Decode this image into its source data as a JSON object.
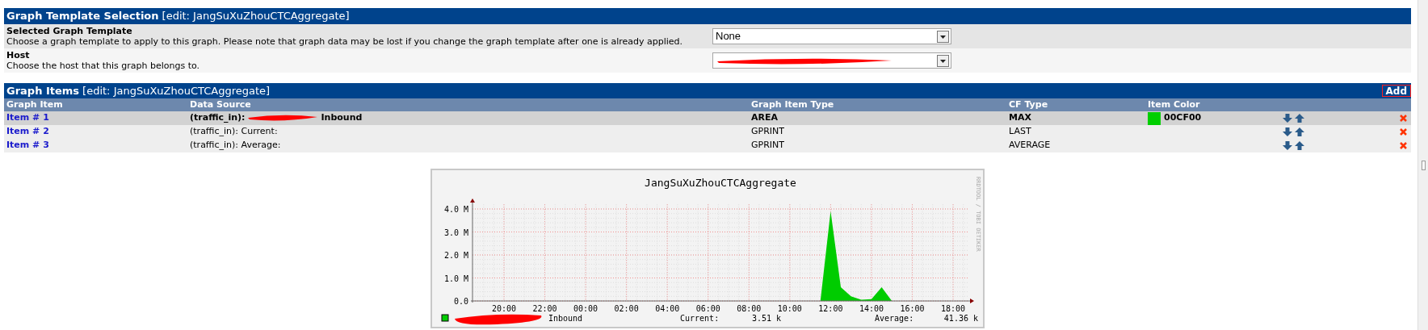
{
  "template_section": {
    "title": "Graph Template Selection",
    "subtitle": "[edit: JangSuXuZhouCTCAggregate]",
    "fields": [
      {
        "label": "Selected Graph Template",
        "description": "Choose a graph template to apply to this graph. Please note that graph data may be lost if you change the graph template after one is already applied.",
        "value": "None"
      },
      {
        "label": "Host",
        "description": "Choose the host that this graph belongs to.",
        "redacted": true
      }
    ]
  },
  "items_section": {
    "title": "Graph Items",
    "subtitle": "[edit: JangSuXuZhouCTCAggregate]",
    "add_button": "Add",
    "columns": [
      "Graph Item",
      "Data Source",
      "Graph Item Type",
      "CF Type",
      "Item Color"
    ],
    "rows": [
      {
        "item": "Item # 1",
        "source_prefix": "(traffic_in):",
        "source_redacted": true,
        "source_suffix": "Inbound",
        "type": "AREA",
        "cf": "MAX",
        "color": "#00cf00",
        "color_label": "00CF00",
        "highlighted": true
      },
      {
        "item": "Item # 2",
        "source_prefix": "(traffic_in): Current:",
        "source_redacted": false,
        "type": "GPRINT",
        "cf": "LAST",
        "highlighted": false
      },
      {
        "item": "Item # 3",
        "source_prefix": "(traffic_in): Average:",
        "source_redacted": false,
        "type": "GPRINT",
        "cf": "AVERAGE",
        "highlighted": false
      }
    ]
  },
  "graph": {
    "side_text": "RRDTOOL / TOBI OETIKER",
    "legend": {
      "color": "#00cc00",
      "redacted": true,
      "current_label": "Current:",
      "current_value": "3.51 k",
      "average_label": "Average:",
      "average_value": "41.36 k"
    },
    "chart_data": {
      "type": "area",
      "grid": true,
      "title": "JangSuXuZhouCTCAggregate",
      "ylim": [
        0,
        4.2
      ],
      "categories": [
        null,
        null,
        "20:00",
        null,
        null,
        null,
        "22:00",
        null,
        null,
        null,
        "00:00",
        null,
        null,
        null,
        "02:00",
        null,
        null,
        null,
        "04:00",
        null,
        null,
        null,
        "06:00",
        null,
        null,
        null,
        "08:00",
        null,
        null,
        null,
        "10:00",
        null,
        null,
        null,
        "12:00",
        null,
        null,
        null,
        "14:00",
        null,
        null,
        null,
        "16:00",
        null,
        null,
        null,
        "18:00",
        null
      ],
      "yticks": [
        {
          "value": 0,
          "label": "0.0"
        },
        {
          "value": 1,
          "label": "1.0 M"
        },
        {
          "value": 2,
          "label": "2.0 M"
        },
        {
          "value": 3,
          "label": "3.0 M"
        },
        {
          "value": 4,
          "label": "4.0 M"
        }
      ],
      "series": [
        {
          "name": "Inbound",
          "color": "#00cc00",
          "values": [
            0,
            0,
            0,
            0,
            0,
            0,
            0,
            0,
            0,
            0,
            0,
            0,
            0,
            0,
            0,
            0,
            0,
            0,
            0,
            0,
            0,
            0,
            0,
            0,
            0,
            0,
            0,
            0,
            0,
            0,
            0,
            0,
            0,
            0,
            3.9,
            0.6,
            0.2,
            0.05,
            0.08,
            0.6,
            0,
            0,
            0,
            0,
            0,
            0,
            0,
            0
          ]
        }
      ]
    }
  }
}
